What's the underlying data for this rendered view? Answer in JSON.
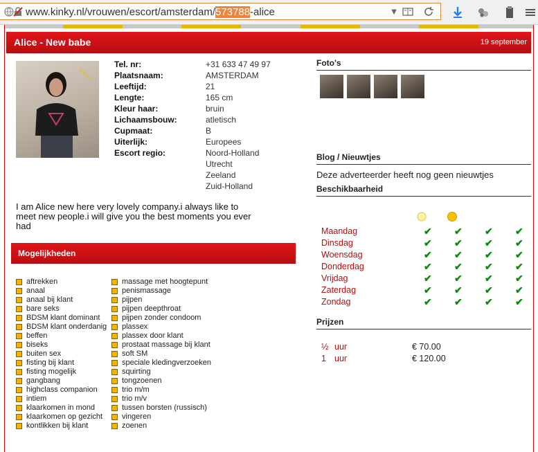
{
  "browser": {
    "url_prefix": "www.kinky.nl/vrouwen/escort/amsterdam/",
    "url_highlight": "573788",
    "url_suffix": "-alice"
  },
  "ad": {
    "title": "Alice - New babe",
    "date": "19 september",
    "details": [
      {
        "label": "Tel. nr:",
        "value": "+31 633 47 49 97"
      },
      {
        "label": "Plaatsnaam:",
        "value": "AMSTERDAM"
      },
      {
        "label": "Leeftijd:",
        "value": "21"
      },
      {
        "label": "Lengte:",
        "value": "165 cm"
      },
      {
        "label": "Kleur haar:",
        "value": "bruin"
      },
      {
        "label": "Lichaamsbouw:",
        "value": "atletisch"
      },
      {
        "label": "Cupmaat:",
        "value": "B"
      },
      {
        "label": "Uiterlijk:",
        "value": "Europees"
      },
      {
        "label": "Escort regio:",
        "value": "Noord-Holland"
      }
    ],
    "regions_extra": [
      "Utrecht",
      "Zeeland",
      "Zuid-Holland"
    ],
    "description": "I am Alice new here very lovely company.i always like to meet new people.i will give you the best moments you ever had"
  },
  "options": {
    "title": "Mogelijkheden",
    "col1": [
      "aftrekken",
      "anaal",
      "anaal bij klant",
      "bare seks",
      "BDSM klant dominant",
      "BDSM klant onderdanig",
      "beffen",
      "biseks",
      "buiten sex",
      "fisting bij klant",
      "fisting mogelijk",
      "gangbang",
      "highclass companion",
      "intiem",
      "klaarkomen in mond",
      "klaarkomen op gezicht",
      "kontlikken bij klant"
    ],
    "col2": [
      "massage met hoogtepunt",
      "penismassage",
      "pijpen",
      "pijpen deepthroat",
      "pijpen zonder condoom",
      "plassex",
      "plassex door klant",
      "prostaat massage bij klant",
      "soft SM",
      "speciale kledingverzoeken",
      "squirting",
      "tongzoenen",
      "trio m/m",
      "trio m/v",
      "tussen borsten (russisch)",
      "vingeren",
      "zoenen"
    ]
  },
  "sidebar": {
    "photos_title": "Foto's",
    "news_title": "Blog / Nieuwtjes",
    "news_text": "Deze adverteerder heeft nog geen nieuwtjes",
    "availability_title": "Beschikbaarheid",
    "days": [
      "Maandag",
      "Dinsdag",
      "Woensdag",
      "Donderdag",
      "Vrijdag",
      "Zaterdag",
      "Zondag"
    ],
    "check_glyph": "✔",
    "prices_title": "Prijzen",
    "prices": [
      {
        "qty": "½",
        "unit": "uur",
        "amount": "€ 70.00"
      },
      {
        "qty": "1",
        "unit": "uur",
        "amount": "€ 120.00"
      }
    ]
  }
}
